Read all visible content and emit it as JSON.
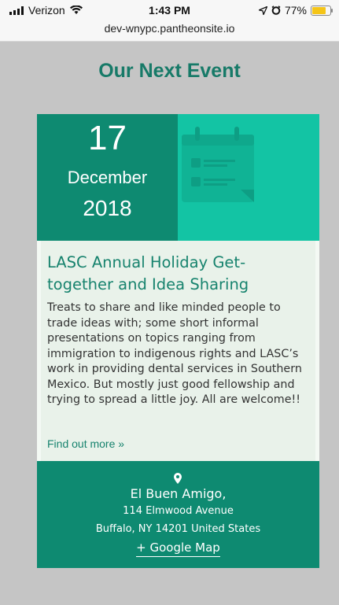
{
  "status_bar": {
    "carrier": "Verizon",
    "time": "1:43 PM",
    "battery": "77%"
  },
  "url_bar": {
    "url": "dev-wnypc.pantheonsite.io"
  },
  "heading": "Our Next Event",
  "event": {
    "day": "17",
    "month": "December",
    "year": "2018",
    "title": "LASC Annual Holiday Get-together and Idea Sharing",
    "description": "Treats to share and like minded people to trade ideas  with; some short informal presentations on topics ranging from immigration to indigenous rights and LASC’s work in providing  dental services in Southern Mexico. But mostly just good fellowship and trying to spread a little joy. All are welcome!!",
    "more_link": "Find out more »",
    "venue": "El Buen Amigo,",
    "street": "114 Elmwood Avenue",
    "city": "Buffalo,  NY  14201  United States",
    "map_link": "+ Google Map"
  },
  "colors": {
    "accent": "#177a68",
    "date_bg": "#0e8a71",
    "calendar_bg": "#13c4a4",
    "body_bg": "#e9f2ea"
  },
  "icons": [
    "signal-icon",
    "wifi-icon",
    "location-arrow-icon",
    "alarm-icon",
    "battery-icon",
    "calendar-icon",
    "map-pin-icon"
  ]
}
